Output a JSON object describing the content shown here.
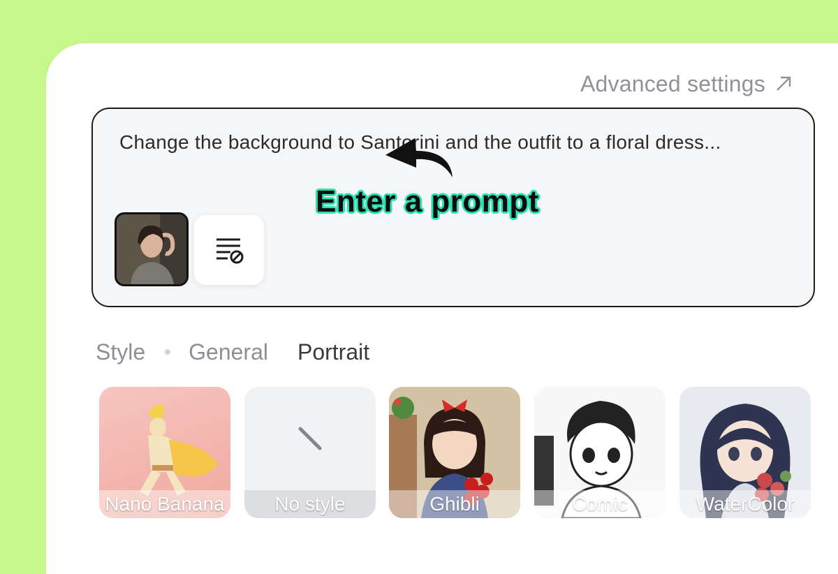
{
  "header": {
    "advanced_settings": "Advanced settings"
  },
  "prompt": {
    "text": "Change the background to Santorini and the outfit to a floral dress..."
  },
  "overlay": {
    "label": "Enter a prompt"
  },
  "tabs": [
    {
      "label": "Style"
    },
    {
      "label": "General"
    },
    {
      "label": "Portrait"
    }
  ],
  "styles": [
    {
      "label": "Nano Banana"
    },
    {
      "label": "No style"
    },
    {
      "label": "Ghibli"
    },
    {
      "label": "Comic"
    },
    {
      "label": "WaterColor"
    }
  ],
  "colors": {
    "page_bg": "#c7f78a",
    "highlight": "#2fe0b3"
  }
}
